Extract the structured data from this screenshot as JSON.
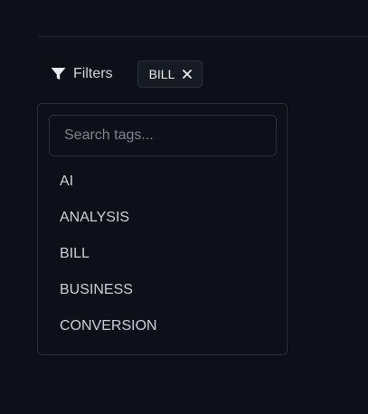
{
  "filters": {
    "label": "Filters",
    "icon": "filter-icon",
    "active_tags": [
      {
        "label": "BILL",
        "remove_icon": "close-icon"
      }
    ]
  },
  "tag_dropdown": {
    "search_placeholder": "Search tags...",
    "search_value": "",
    "options": [
      {
        "label": "AI"
      },
      {
        "label": "ANALYSIS"
      },
      {
        "label": "BILL"
      },
      {
        "label": "BUSINESS"
      },
      {
        "label": "CONVERSION"
      }
    ]
  },
  "colors": {
    "background": "#0d1117",
    "border": "#2b313a",
    "text": "#c9d1d9",
    "placeholder": "#7d8590"
  }
}
